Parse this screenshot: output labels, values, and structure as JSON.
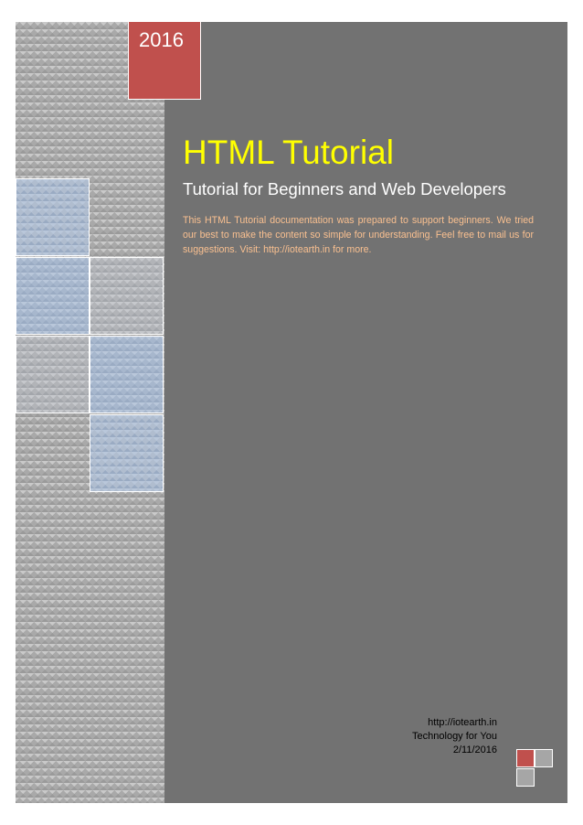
{
  "cover": {
    "year": "2016",
    "title": "HTML Tutorial",
    "subtitle": "Tutorial for Beginners and Web Developers",
    "description": "This HTML Tutorial documentation was prepared to support beginners. We tried our best to make the content so simple for understanding. Feel free to mail us for suggestions. Visit: http://iotearth.in for more.",
    "footer": {
      "website": "http://iotearth.in",
      "tagline": "Technology for You",
      "date": "2/11/2016"
    }
  },
  "colors": {
    "accent_red": "#c0504d",
    "title_yellow": "#ffff00",
    "description_orange": "#fac090",
    "panel_grey": "#727272",
    "tile_blue": "#a7b7cd"
  }
}
